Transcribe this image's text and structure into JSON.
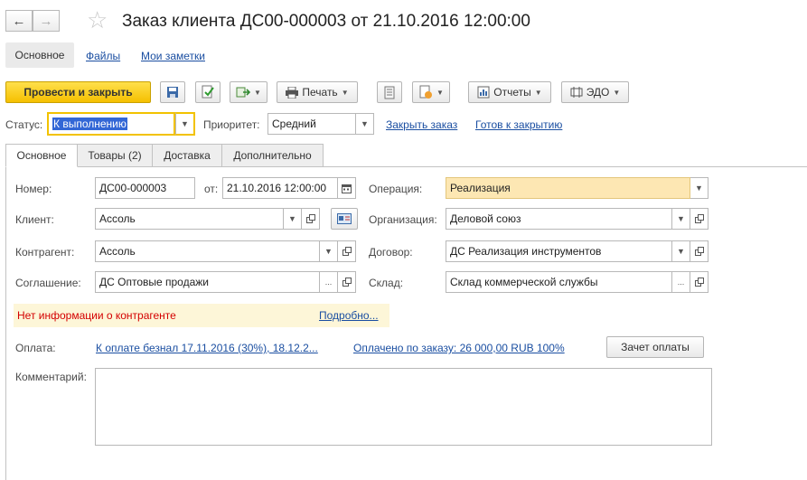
{
  "window": {
    "title": "Заказ клиента ДС00-000003 от 21.10.2016 12:00:00"
  },
  "nav": {
    "back_icon": "←",
    "forward_icon": "→",
    "star_icon": "☆"
  },
  "topnav": {
    "main": "Основное",
    "files": "Файлы",
    "notes": "Мои заметки"
  },
  "toolbar": {
    "post_close": "Провести и закрыть",
    "print": "Печать",
    "reports": "Отчеты",
    "edo": "ЭДО"
  },
  "status_row": {
    "status_label": "Статус:",
    "status_value": "К выполнению",
    "priority_label": "Приоритет:",
    "priority_value": "Средний",
    "close_order": "Закрыть заказ",
    "ready_to_close": "Готов к закрытию"
  },
  "tabs": [
    "Основное",
    "Товары (2)",
    "Доставка",
    "Дополнительно"
  ],
  "form": {
    "number_label": "Номер:",
    "number_value": "ДС00-000003",
    "from_label": "от:",
    "date_value": "21.10.2016 12:00:00",
    "operation_label": "Операция:",
    "operation_value": "Реализация",
    "client_label": "Клиент:",
    "client_value": "Ассоль",
    "organization_label": "Организация:",
    "organization_value": "Деловой союз",
    "counterparty_label": "Контрагент:",
    "counterparty_value": "Ассоль",
    "contract_label": "Договор:",
    "contract_value": "ДС Реализация инструментов",
    "agreement_label": "Соглашение:",
    "agreement_value": "ДС Оптовые продажи",
    "warehouse_label": "Склад:",
    "warehouse_value": "Склад коммерческой службы",
    "warning_text": "Нет информации о контрагенте",
    "details_link": "Подробно...",
    "payment_label": "Оплата:",
    "payment_link": "К оплате безнал 17.11.2016 (30%), 18.12.2...",
    "paid_link": "Оплачено по заказу: 26 000,00 RUB  100%",
    "offset_button": "Зачет оплаты",
    "comment_label": "Комментарий:",
    "comment_value": ""
  },
  "colors": {
    "primary_button": "#f5c000",
    "highlight_field": "#fde7b3",
    "warning_text": "#d40000",
    "link": "#1a4ea1"
  }
}
